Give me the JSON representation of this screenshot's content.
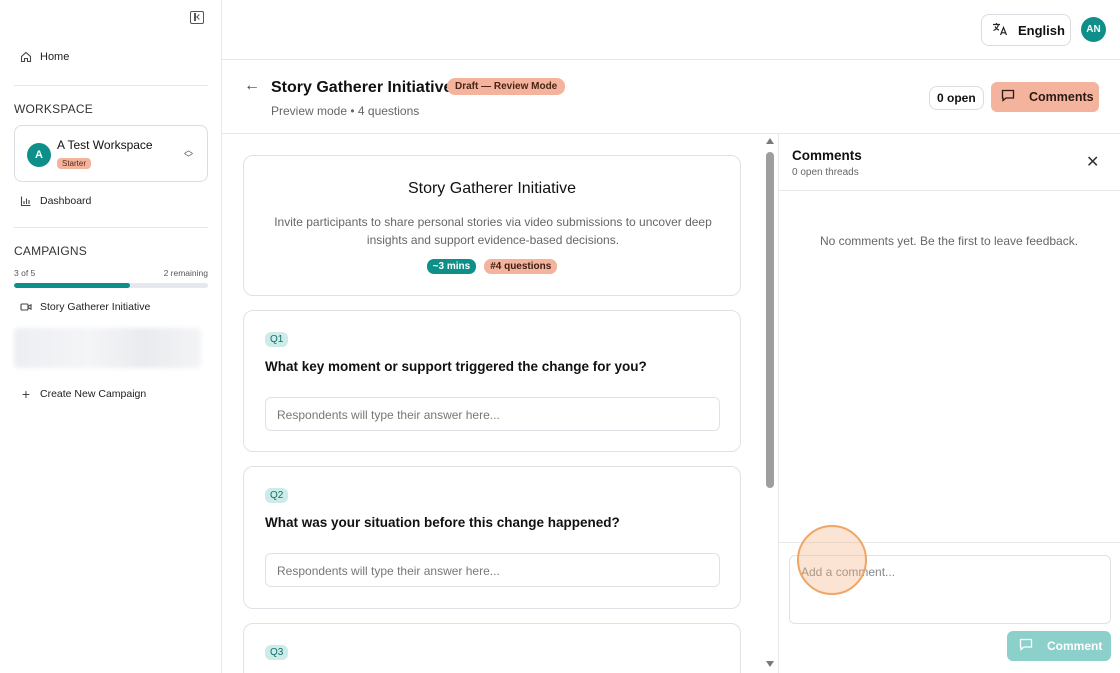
{
  "sidebar": {
    "home_label": "Home",
    "workspace_section": "WORKSPACE",
    "workspace": {
      "avatar_letter": "A",
      "name": "A Test Workspace",
      "plan_badge": "Starter"
    },
    "dashboard_label": "Dashboard",
    "campaigns_section": "CAMPAIGNS",
    "campaign_progress": {
      "used_label": "3 of 5",
      "remaining_label": "2 remaining",
      "fraction": 0.6
    },
    "campaign_item": "Story Gatherer Initiative",
    "create_label": "Create New Campaign"
  },
  "topbar": {
    "language": "English",
    "user_initials": "AN"
  },
  "header": {
    "title": "Story Gatherer Initiative",
    "status_badge": "Draft — Review Mode",
    "subtitle": "Preview mode • 4 questions",
    "open_count": "0 open",
    "comments_button": "Comments"
  },
  "intro": {
    "title": "Story Gatherer Initiative",
    "description": "Invite participants to share personal stories via video submissions to uncover deep insights and support evidence-based decisions.",
    "duration_tag": "~3 mins",
    "questions_tag": "#4 questions"
  },
  "questions": [
    {
      "badge": "Q1",
      "text": "What key moment or support triggered the change for you?",
      "placeholder": "Respondents will type their answer here..."
    },
    {
      "badge": "Q2",
      "text": "What was your situation before this change happened?",
      "placeholder": "Respondents will type their answer here..."
    },
    {
      "badge": "Q3"
    }
  ],
  "comments_panel": {
    "title": "Comments",
    "subtitle": "0 open threads",
    "empty_message": "No comments yet. Be the first to leave feedback.",
    "input_placeholder": "Add a comment...",
    "submit_label": "Comment"
  },
  "colors": {
    "accent_teal": "#0f8f8a",
    "accent_peach": "#f4b39c",
    "button_disabled_teal": "#8cd0cb"
  }
}
